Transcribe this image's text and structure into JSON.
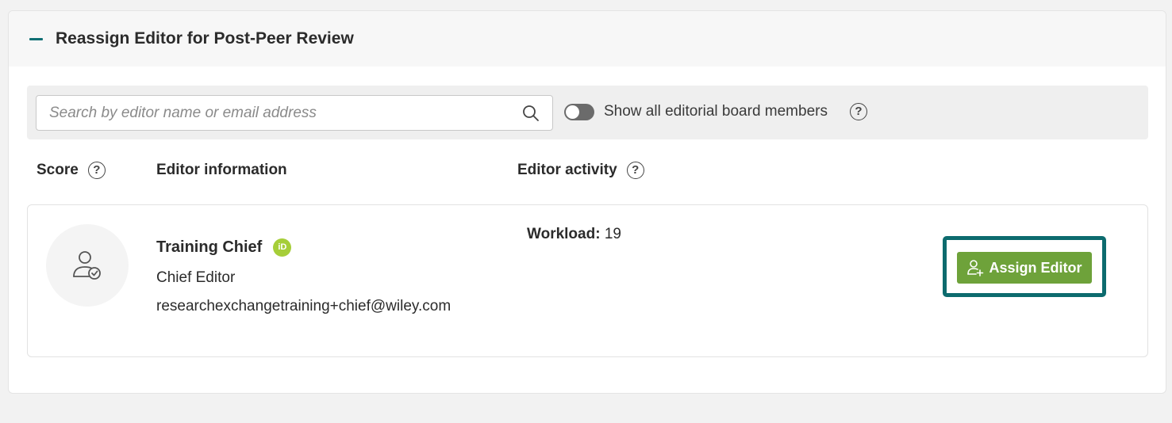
{
  "panel": {
    "title": "Reassign Editor for Post-Peer Review",
    "collapse_icon": "minus-icon"
  },
  "search": {
    "placeholder": "Search by editor name or email address",
    "value": "",
    "icon": "search-icon"
  },
  "toggle": {
    "label": "Show all editorial board members",
    "checked": false
  },
  "columns": {
    "score": "Score",
    "editor_information": "Editor information",
    "editor_activity": "Editor activity"
  },
  "editors": [
    {
      "name": "Training Chief",
      "badge": "iD",
      "role": "Chief Editor",
      "email": "researchexchangetraining+chief@wiley.com",
      "workload_label": "Workload:",
      "workload_value": "19",
      "action_label": "Assign Editor"
    }
  ],
  "colors": {
    "accent_teal": "#0d6b6e",
    "button_green": "#6ea23a",
    "orcid_green": "#a6ce39"
  }
}
